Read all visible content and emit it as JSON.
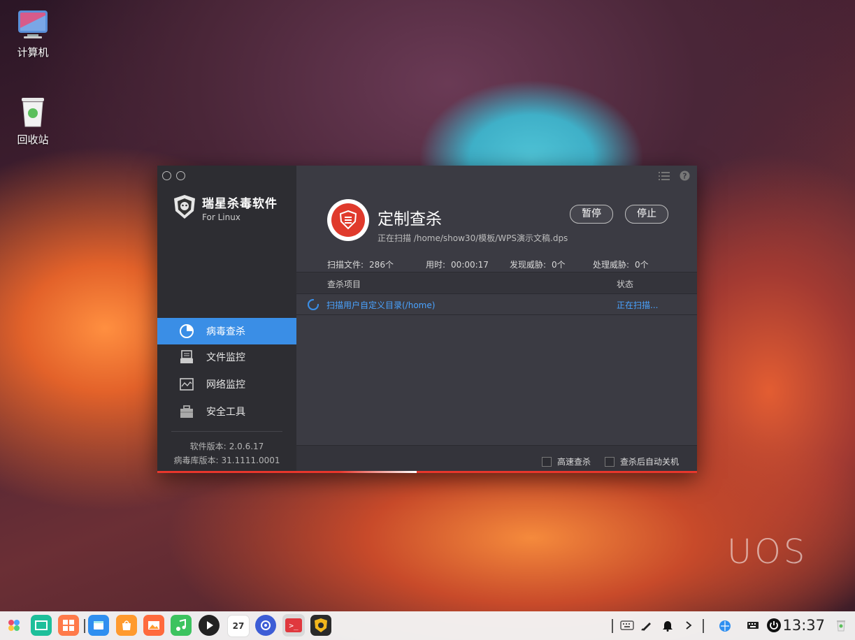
{
  "desktop": {
    "icons": [
      {
        "label": "计算机",
        "icon": "computer-icon"
      },
      {
        "label": "回收站",
        "icon": "trash-icon"
      }
    ],
    "watermark": "UOS"
  },
  "window": {
    "brand": {
      "name": "瑞星杀毒软件",
      "sub": "For Linux",
      "icon": "rising-lion-shield-icon"
    },
    "nav": [
      {
        "label": "病毒查杀",
        "icon": "pie-chart-icon",
        "active": true
      },
      {
        "label": "文件监控",
        "icon": "document-tray-icon",
        "active": false
      },
      {
        "label": "网络监控",
        "icon": "network-wave-icon",
        "active": false
      },
      {
        "label": "安全工具",
        "icon": "toolbox-icon",
        "active": false
      }
    ],
    "version": {
      "software_label": "软件版本:",
      "software_value": "2.0.6.17",
      "db_label": "病毒库版本:",
      "db_value": "31.1111.0001"
    },
    "top_icons": [
      "menu-list-icon",
      "help-icon"
    ],
    "scan": {
      "title": "定制查杀",
      "status_path": "正在扫描 /home/show30/模板/WPS演示文稿.dps",
      "pause_label": "暂停",
      "stop_label": "停止",
      "stats": [
        {
          "label": "扫描文件:",
          "value": "286个"
        },
        {
          "label": "用时:",
          "value": "00:00:17"
        },
        {
          "label": "发现威胁:",
          "value": "0个"
        },
        {
          "label": "处理威胁:",
          "value": "0个"
        }
      ],
      "table": {
        "col_item": "查杀项目",
        "col_status": "状态",
        "rows": [
          {
            "item": "扫描用户自定义目录(/home)",
            "status": "正在扫描..."
          }
        ]
      },
      "options": [
        {
          "label": "高速查杀",
          "checked": false
        },
        {
          "label": "查杀后自动关机",
          "checked": false
        }
      ],
      "progress": 0.48
    }
  },
  "taskbar": {
    "apps": [
      "launcher-icon",
      "multitask-view-icon",
      "app-grid-icon",
      "file-manager-icon",
      "app-store-icon",
      "image-viewer-icon",
      "music-icon",
      "video-player-icon",
      "calendar-icon",
      "settings-icon",
      "terminal-icon",
      "rising-antivirus-icon"
    ],
    "calendar_day": "27",
    "tray": [
      "keyboard-icon",
      "pen-icon",
      "bell-icon",
      "chevron-right-icon",
      "network-icon",
      "ime-keyboard-icon",
      "power-icon"
    ],
    "time": "13:37",
    "colors": {
      "accent": "#3a8ee6",
      "danger": "#e03a2c"
    }
  }
}
